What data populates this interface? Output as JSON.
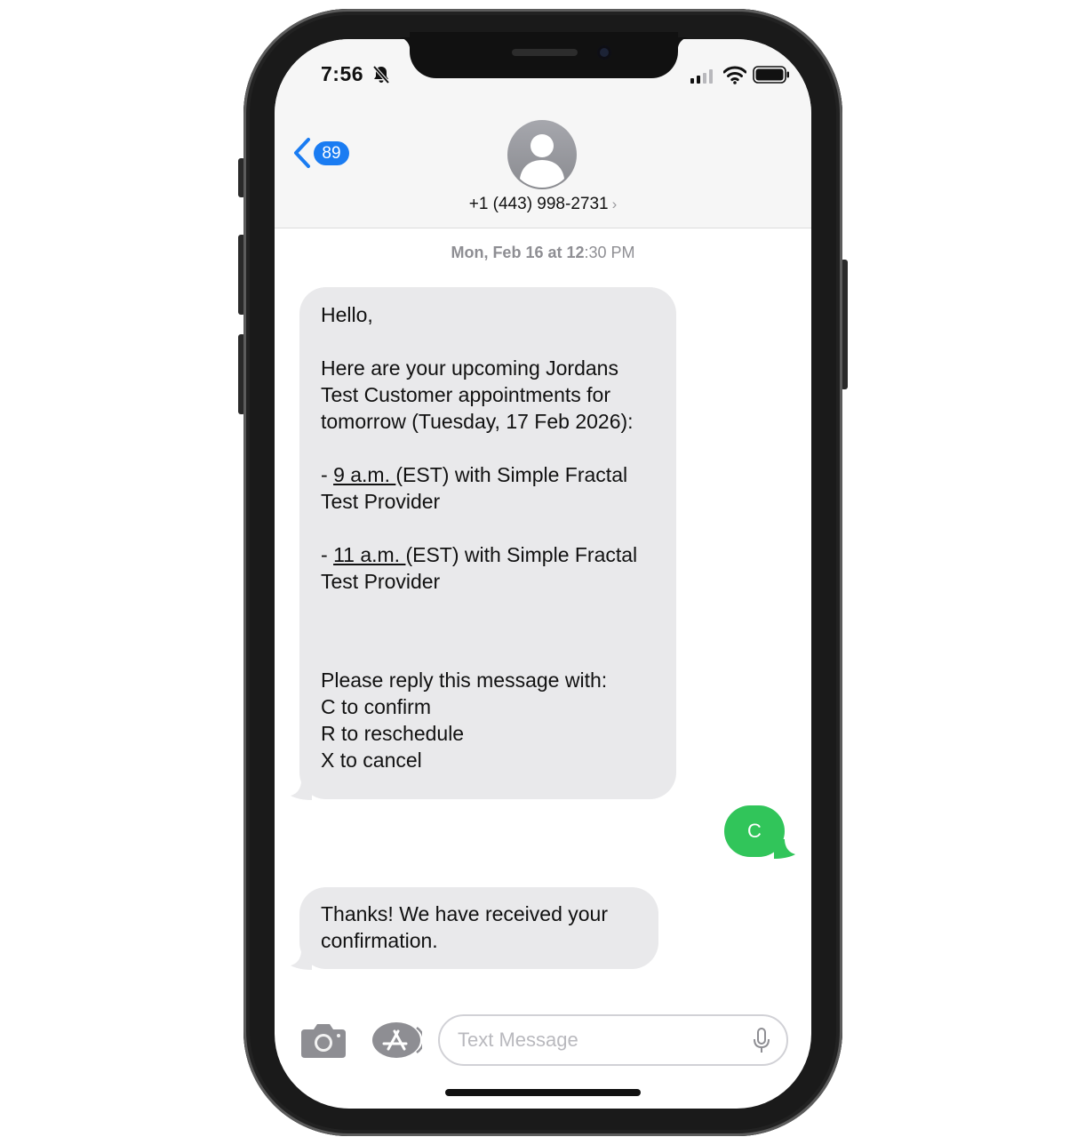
{
  "status_bar": {
    "time": "7:56"
  },
  "header": {
    "back_badge": "89",
    "contact": "+1 (443) 998-2731",
    "chevron": "›"
  },
  "conversation": {
    "timestamp_day": "Mon, Feb 16",
    "timestamp_at": "at 12",
    "timestamp_time": ":30 PM",
    "message1": {
      "greeting": "Hello,",
      "intro_1": "Here are your upcoming Jordans",
      "intro_2": "Test Customer appointments for",
      "intro_3": "tomorrow (Tuesday, 17 Feb 2026):",
      "appt1_dash": "- ",
      "appt1_time": "9 a.m. ",
      "appt1_rest": "(EST) with Simple Fractal",
      "appt1_line2": "Test Provider",
      "appt2_dash": "- ",
      "appt2_time": "11 a.m. ",
      "appt2_rest": "(EST) with Simple Fractal",
      "appt2_line2": "Test Provider",
      "reply_intro": "Please reply this message with:",
      "opt_confirm": "C to confirm",
      "opt_reschedule": "R to reschedule",
      "opt_cancel": "X to cancel"
    },
    "message2": "C",
    "message3_line1": "Thanks! We have received your",
    "message3_line2": "confirmation."
  },
  "composer": {
    "placeholder": "Text Message"
  },
  "colors": {
    "accent_blue": "#1a7cf2",
    "sent_green": "#31c55a",
    "received_gray": "#e9e9eb"
  },
  "icons": {
    "bell": "bell-slash-icon",
    "signal": "cellular-signal-icon",
    "wifi": "wifi-icon",
    "battery": "battery-icon",
    "back": "chevron-left-icon",
    "avatar": "person-avatar-icon",
    "camera": "camera-icon",
    "apps": "app-store-icon",
    "mic": "microphone-icon"
  }
}
